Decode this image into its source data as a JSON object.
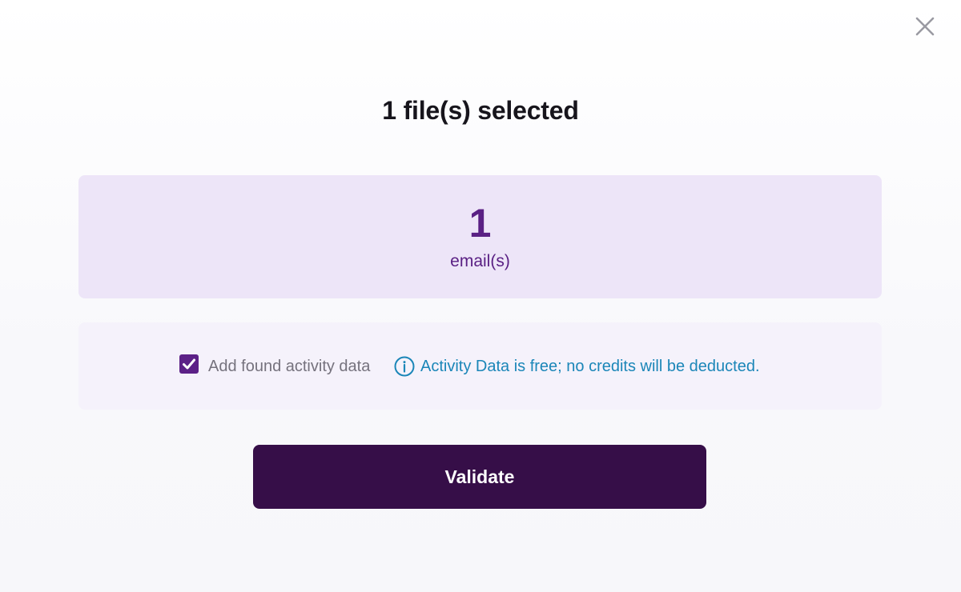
{
  "dialog": {
    "title": "1 file(s) selected",
    "close_icon": "close-icon"
  },
  "summary": {
    "count": "1",
    "unit": "email(s)"
  },
  "options": {
    "activity_checkbox": {
      "checked": true,
      "label": "Add found activity data"
    },
    "info": {
      "icon": "info-icon",
      "text": "Activity Data is free; no credits will be deducted."
    }
  },
  "actions": {
    "validate_label": "Validate"
  },
  "colors": {
    "accent_purple": "#5c2187",
    "button_dark": "#360e48",
    "count_card_bg": "#ede5f8",
    "options_card_bg": "#f5f2fb",
    "info_blue": "#1b86b8"
  }
}
